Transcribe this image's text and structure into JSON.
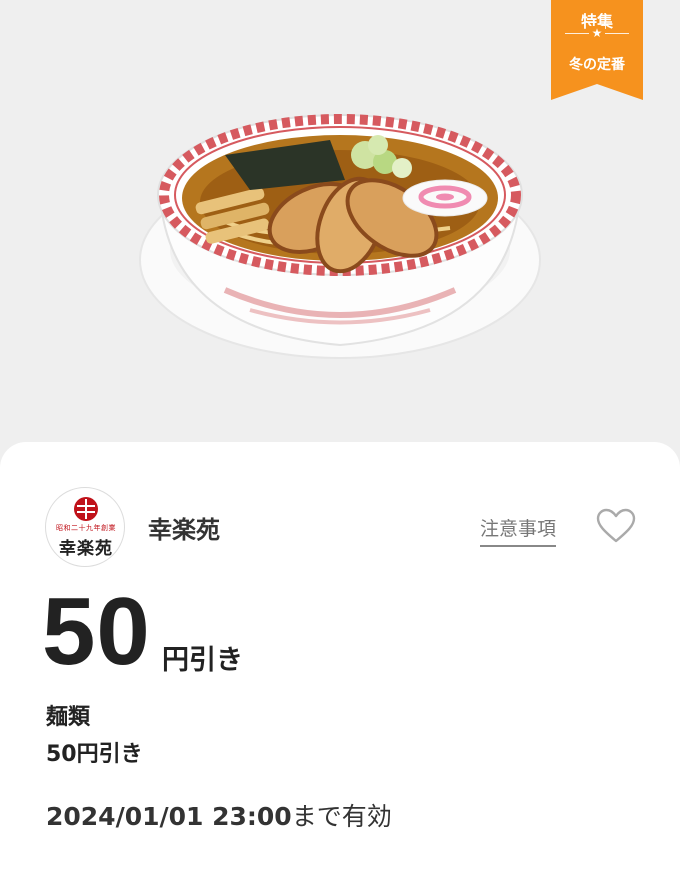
{
  "badge": {
    "top": "特集",
    "star": "★",
    "bottom": "冬の定番",
    "color": "#f6921e"
  },
  "hero": {
    "image": "ramen-bowl-photo"
  },
  "shop": {
    "logo_small_text": "昭和二十九年創業",
    "logo_main_text": "幸楽苑",
    "name": "幸楽苑",
    "notes_link": "注意事項",
    "favorite_icon": "heart-outline-icon"
  },
  "coupon": {
    "amount": "50",
    "unit": "円引き",
    "category": "麺類",
    "description": "50円引き",
    "expiry_datetime": "2024/01/01 23:00",
    "expiry_suffix": "まで有効"
  }
}
